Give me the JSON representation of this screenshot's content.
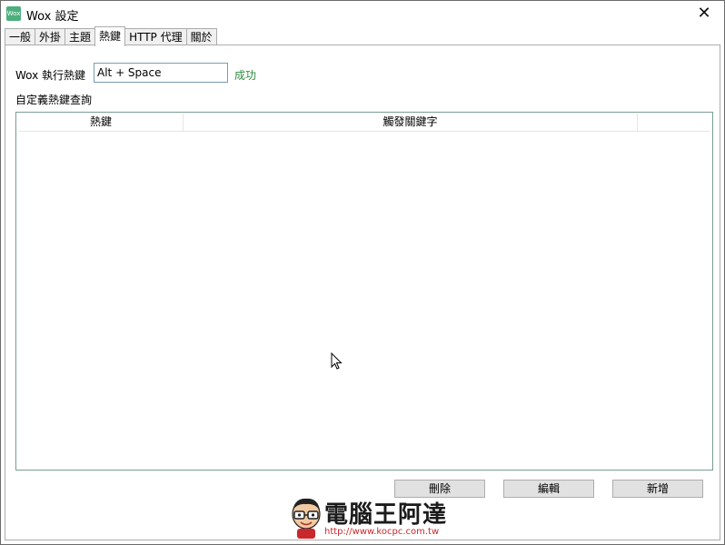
{
  "window": {
    "title": "Wox 設定",
    "icon_text": "Wox",
    "close_glyph": "✕"
  },
  "tabs": [
    {
      "label": "一般",
      "active": false
    },
    {
      "label": "外掛",
      "active": false
    },
    {
      "label": "主題",
      "active": false
    },
    {
      "label": "熱鍵",
      "active": true
    },
    {
      "label": "HTTP 代理",
      "active": false
    },
    {
      "label": "關於",
      "active": false
    }
  ],
  "hotkey": {
    "label": "Wox 執行熱鍵",
    "value": "Alt + Space",
    "status": "成功",
    "status_color": "#2e8b3e"
  },
  "custom": {
    "label": "自定義熱鍵查詢",
    "columns": [
      "熱鍵",
      "觸發關鍵字",
      ""
    ],
    "rows": []
  },
  "buttons": {
    "delete": "刪除",
    "edit": "編輯",
    "add": "新增"
  },
  "watermark": {
    "brand": "電腦王阿達",
    "url": "http://www.kocpc.com.tw"
  },
  "icons": {
    "cursor": "mouse-pointer-icon",
    "close": "close-icon",
    "app": "wox-app-icon"
  }
}
